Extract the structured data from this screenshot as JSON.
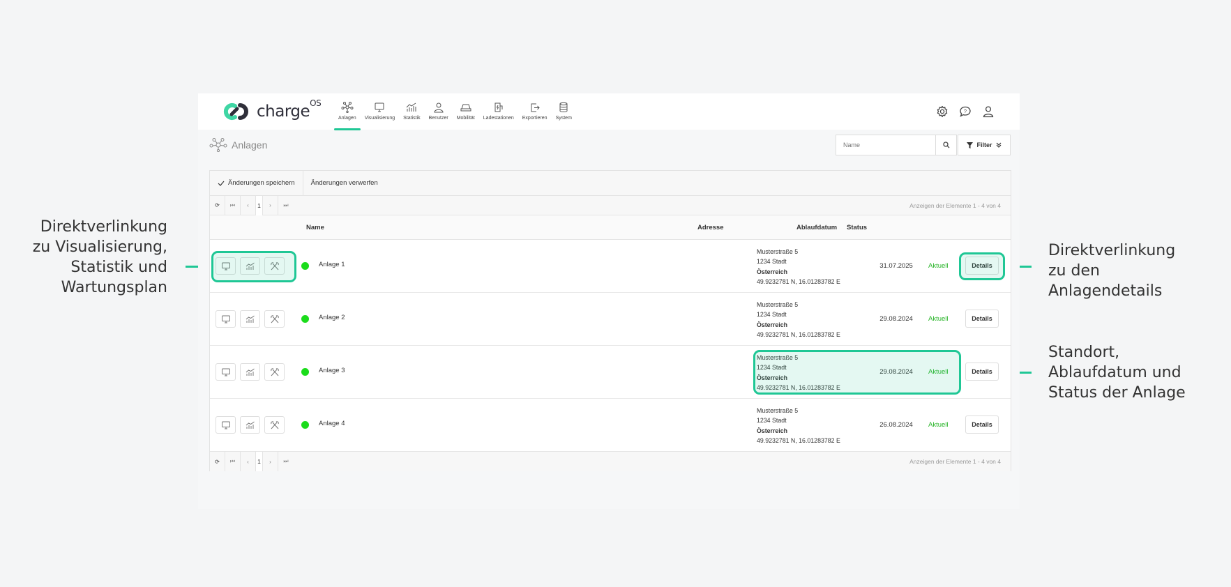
{
  "app": {
    "logo": {
      "text": "charge",
      "sup": "OS"
    },
    "nav": [
      {
        "label": "Anlagen",
        "icon": "network-icon",
        "active": true
      },
      {
        "label": "Visualisierung",
        "icon": "monitor-icon"
      },
      {
        "label": "Statistik",
        "icon": "chart-icon"
      },
      {
        "label": "Benutzer",
        "icon": "user-icon"
      },
      {
        "label": "Mobilität",
        "icon": "car-icon"
      },
      {
        "label": "Ladestationen",
        "icon": "charging-station-icon"
      },
      {
        "label": "Exportieren",
        "icon": "export-icon"
      },
      {
        "label": "System",
        "icon": "database-icon"
      }
    ],
    "top_icons": [
      "gear-icon",
      "help-chat-icon",
      "user-account-icon"
    ],
    "page_title": "Anlagen",
    "search": {
      "placeholder": "Name"
    },
    "filter_label": "Filter",
    "toolbar": {
      "save": "Änderungen speichern",
      "discard": "Änderungen verwerfen"
    },
    "pager": {
      "page": "1",
      "info": "Anzeigen der Elemente 1 - 4 von 4"
    },
    "columns": {
      "name": "Name",
      "address": "Adresse",
      "expiry": "Ablaufdatum",
      "status": "Status"
    },
    "rows": [
      {
        "name": "Anlage 1",
        "street": "Musterstraße 5",
        "city": "1234 Stadt",
        "country": "Österreich",
        "coords": "49.9232781 N, 16.01283782 E",
        "date": "31.07.2025",
        "status": "Aktuell",
        "details": "Details"
      },
      {
        "name": "Anlage 2",
        "street": "Musterstraße 5",
        "city": "1234 Stadt",
        "country": "Österreich",
        "coords": "49.9232781 N, 16.01283782 E",
        "date": "29.08.2024",
        "status": "Aktuell",
        "details": "Details"
      },
      {
        "name": "Anlage 3",
        "street": "Musterstraße 5",
        "city": "1234 Stadt",
        "country": "Österreich",
        "coords": "49.9232781 N, 16.01283782 E",
        "date": "29.08.2024",
        "status": "Aktuell",
        "details": "Details"
      },
      {
        "name": "Anlage 4",
        "street": "Musterstraße 5",
        "city": "1234 Stadt",
        "country": "Österreich",
        "coords": "49.9232781 N, 16.01283782 E",
        "date": "26.08.2024",
        "status": "Aktuell",
        "details": "Details"
      }
    ]
  },
  "callouts": {
    "left": [
      "Direktverlinkung",
      "zu Visualisierung,",
      "Statistik und",
      "Wartungsplan"
    ],
    "right_top": [
      "Direktverlinkung",
      "zu den",
      "Anlagendetails"
    ],
    "right_bottom": [
      "Standort,",
      "Ablaufdatum und",
      "Status der Anlage"
    ]
  },
  "colors": {
    "accent": "#1fc795",
    "status_dot": "#1bdc1b",
    "status_text": "#25b325"
  }
}
